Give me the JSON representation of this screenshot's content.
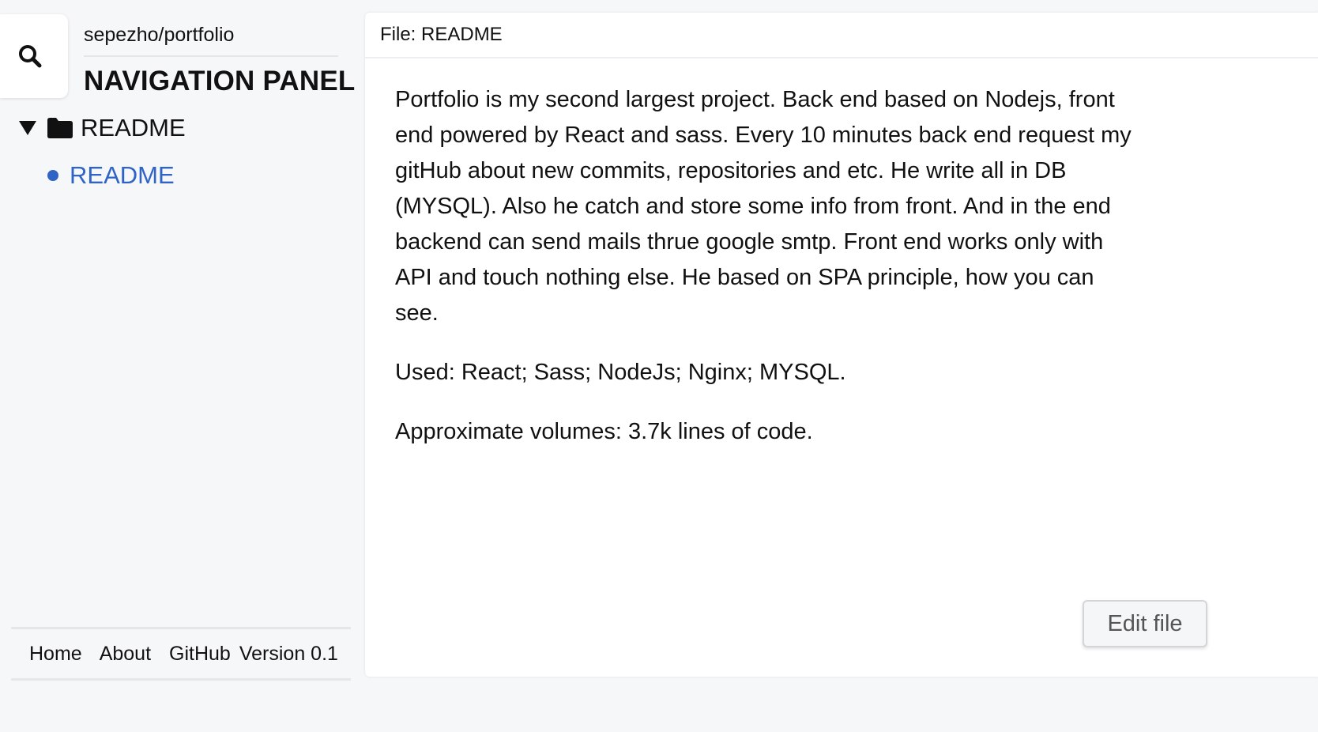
{
  "sidebar": {
    "search_icon": "search-icon",
    "repo_name": "sepezho/portfolio",
    "panel_title": "NAVIGATION PANEL",
    "tree": {
      "folder": {
        "label": "README",
        "expanded": true,
        "icon": "folder-icon"
      },
      "files": [
        {
          "label": "README",
          "active": true
        }
      ]
    }
  },
  "footer": {
    "links": [
      "Home",
      "About",
      "GitHub"
    ],
    "version": "Version 0.1"
  },
  "file_view": {
    "header": "File: README",
    "paragraphs": [
      "Portfolio is my second largest project. Back end based on Nodejs, front end powered by React and sass. Every 10 minutes back end request my gitHub about new commits, repositories and etc. He write all in DB (MYSQL). Also he catch and store some info from front. And in the end backend can send mails thrue google smtp. Front end works only with API and touch nothing else. He based on SPA principle, how you can see.",
      "Used: React; Sass; NodeJs; Nginx; MYSQL.",
      "Approximate volumes: 3.7k lines of code."
    ],
    "edit_button": "Edit file"
  },
  "colors": {
    "accent": "#2f63c5",
    "background": "#f6f7f9",
    "panel": "#ffffff"
  }
}
